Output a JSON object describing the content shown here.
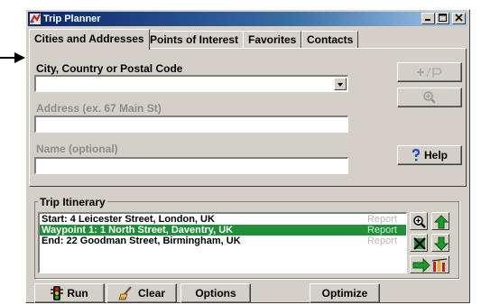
{
  "window": {
    "title": "Trip Planner"
  },
  "tabs": [
    {
      "label": "Cities and Addresses"
    },
    {
      "label": "Points of Interest"
    },
    {
      "label": "Favorites"
    },
    {
      "label": "Contacts"
    }
  ],
  "form": {
    "city_label": "City, Country or Postal Code",
    "city_value": "",
    "address_label": "Address (ex. 67 Main St)",
    "address_value": "",
    "name_label": "Name (optional)",
    "name_value": ""
  },
  "side": {
    "help_label": "Help"
  },
  "itinerary": {
    "title": "Trip Itinerary",
    "report_label": "Report",
    "rows": [
      {
        "text": "Start: 4 Leicester Street, London, UK"
      },
      {
        "text": "Waypoint 1: 1 North Street, Daventry, UK"
      },
      {
        "text": "End: 22 Goodman Street, Birmingham, UK"
      }
    ]
  },
  "bottom": {
    "run_label": "Run",
    "clear_label": "Clear",
    "options_label": "Options",
    "optimize_label": "Optimize"
  },
  "colors": {
    "selection": "#1f8f3a",
    "title_bar": "#0a246a",
    "face": "#d4d0c8"
  }
}
